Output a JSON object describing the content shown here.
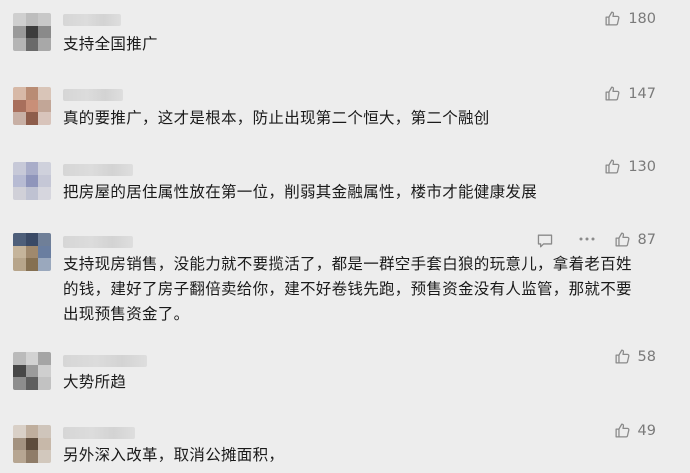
{
  "comments": [
    {
      "text": "支持全国推广",
      "likes": "180",
      "avatar_colors": [
        "#cfcfcf",
        "#bdbdbd",
        "#c8c8c8",
        "#9a9a9a",
        "#3d3d3d",
        "#8a8a8a",
        "#b5b5b5",
        "#6a6a6a",
        "#a8a8a8"
      ]
    },
    {
      "text": "真的要推广，这才是根本，防止出现第二个恒大，第二个融创",
      "likes": "147",
      "avatar_colors": [
        "#d7b9a7",
        "#b98c74",
        "#d9c5b8",
        "#a86f5c",
        "#c98f78",
        "#c2a697",
        "#c8b0a5",
        "#8e5d4b",
        "#d8c4bb"
      ]
    },
    {
      "text": "把房屋的居住属性放在第一位，削弱其金融属性，楼市才能健康发展",
      "likes": "130",
      "avatar_colors": [
        "#c7c9d8",
        "#a9adc9",
        "#cfd1dc",
        "#b7bbd3",
        "#8f95bb",
        "#c5c7d6",
        "#d0d0d8",
        "#bfc2d2",
        "#d6d6de"
      ]
    },
    {
      "text": "支持现房销售，没能力就不要揽活了，都是一群空手套白狼的玩意儿，拿着老百姓的钱，建好了房子翻倍卖给你，建不好卷钱先跑，预售资金没有人监管，那就不要出现预售资金了。",
      "likes": "87",
      "avatar_colors": [
        "#4e5f7a",
        "#3a4a66",
        "#6f7f98",
        "#c5b49b",
        "#a0896d",
        "#6a7ea0",
        "#b7a58b",
        "#857052",
        "#9aa8bd"
      ]
    },
    {
      "text": "大势所趋",
      "likes": "58",
      "avatar_colors": [
        "#bbbbbb",
        "#d2d2d2",
        "#a5a5a5",
        "#474747",
        "#9b9b9b",
        "#cfcfcf",
        "#8d8d8d",
        "#5e5e5e",
        "#c2c2c2"
      ]
    },
    {
      "text": "另外深入改革，取消公摊面积，",
      "likes": "49",
      "avatar_colors": [
        "#d9d0c7",
        "#bfae9d",
        "#cfc5bb",
        "#a39280",
        "#5e4c3c",
        "#c7b8a9",
        "#b7a692",
        "#8f7c68",
        "#d2c8bd"
      ]
    }
  ]
}
